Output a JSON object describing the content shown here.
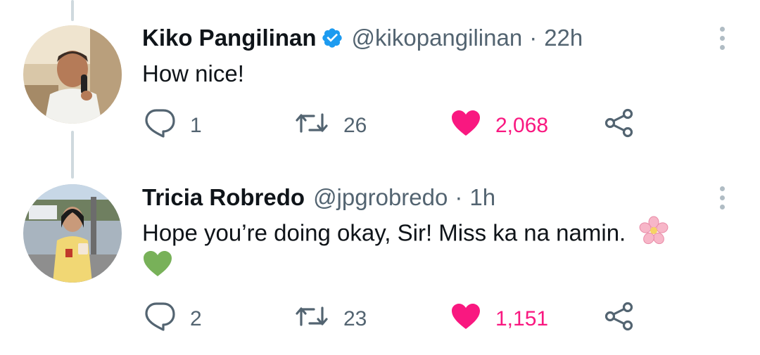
{
  "tweets": [
    {
      "name": "Kiko Pangilinan",
      "verified": true,
      "handle": "@kikopangilinan",
      "separator": "·",
      "time": "22h",
      "text": "How nice!",
      "stats": {
        "replies": "1",
        "retweets": "26",
        "likes": "2,068"
      },
      "liked": true
    },
    {
      "name": "Tricia Robredo",
      "verified": false,
      "handle": "@jpgrobredo",
      "separator": "·",
      "time": "1h",
      "text": "Hope you’re doing okay, Sir! Miss ka na namin.",
      "emojis": [
        "cherry-blossom",
        "green-heart"
      ],
      "stats": {
        "replies": "2",
        "retweets": "23",
        "likes": "1,151"
      },
      "liked": true
    }
  ],
  "colors": {
    "like_active": "#f91880",
    "verified_badge": "#1d9bf0",
    "secondary_text": "#536471",
    "thread_line": "#cfd9de"
  },
  "icons": [
    "reply-icon",
    "retweet-icon",
    "heart-icon",
    "share-icon",
    "verified-icon",
    "more-icon"
  ]
}
